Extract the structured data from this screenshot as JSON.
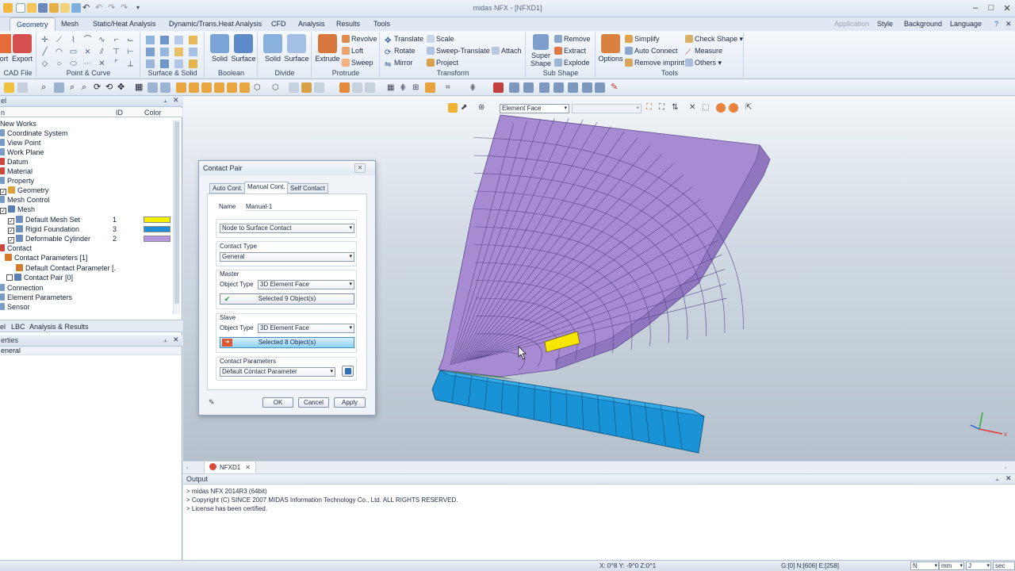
{
  "window": {
    "title": "midas NFX - [NFXD1]"
  },
  "menu_tabs": [
    "Geometry",
    "Mesh",
    "Static/Heat Analysis",
    "Dynamic/Trans.Heat Analysis",
    "CFD",
    "Analysis",
    "Results",
    "Tools"
  ],
  "right_menu": {
    "application": "Application",
    "style": "Style",
    "background": "Background",
    "language": "Language"
  },
  "ribbon": {
    "cad": {
      "label": "CAD File",
      "import": "ort",
      "export": "Export"
    },
    "point_curve": {
      "label": "Point & Curve"
    },
    "surface_solid": {
      "label": "Surface & Solid"
    },
    "boolean": {
      "label": "Boolean",
      "solid": "Solid",
      "surface": "Surface"
    },
    "divide": {
      "label": "Divide",
      "solid": "Solid",
      "surface": "Surface"
    },
    "protrude": {
      "label": "Protrude",
      "extrude": "Extrude",
      "revolve": "Revolve",
      "loft": "Loft",
      "sweep": "Sweep"
    },
    "transform": {
      "label": "Transform",
      "translate": "Translate",
      "rotate": "Rotate",
      "mirror": "Mirror",
      "scale": "Scale",
      "sweep_translate": "Sweep-Translate",
      "project": "Project",
      "attach": "Attach"
    },
    "sub_shape": {
      "label": "Sub Shape",
      "super_shape_1": "Super",
      "super_shape_2": "Shape",
      "remove": "Remove",
      "extract": "Extract",
      "explode": "Explode"
    },
    "tools": {
      "label": "Tools",
      "options": "Options",
      "simplify": "Simplify",
      "auto_connect": "Auto Connect",
      "remove_imprint": "Remove imprint",
      "check_shape": "Check Shape",
      "measure": "Measure",
      "others": "Others"
    }
  },
  "left_panel": {
    "head_fragment": "el",
    "columns": {
      "id": "ID",
      "color": "Color",
      "name_fragment": "n"
    },
    "tree": [
      {
        "label": "New Works",
        "indent": 0
      },
      {
        "label": "Coordinate System",
        "indent": 1
      },
      {
        "label": "View Point",
        "indent": 1
      },
      {
        "label": "Work Plane",
        "indent": 1
      },
      {
        "label": "Datum",
        "indent": 1
      },
      {
        "label": "Material",
        "indent": 1
      },
      {
        "label": "Property",
        "indent": 1
      },
      {
        "label": "Geometry",
        "indent": 1
      },
      {
        "label": "Mesh Control",
        "indent": 1
      },
      {
        "label": "Mesh",
        "indent": 1
      }
    ],
    "mesh_sets": [
      {
        "label": "Default Mesh Set",
        "id": "1",
        "color": "#f5f000"
      },
      {
        "label": "Rigid Foundation",
        "id": "3",
        "color": "#1e8fd6"
      },
      {
        "label": "Deformable Cylinder",
        "id": "2",
        "color": "#b396dc"
      }
    ],
    "tree2": [
      {
        "label": "Contact"
      },
      {
        "label": "Contact Parameters [1]"
      },
      {
        "label": "Default Contact Parameter [."
      },
      {
        "label": "Contact Pair [0]"
      },
      {
        "label": "Connection"
      },
      {
        "label": "Element Parameters"
      },
      {
        "label": "Sensor"
      }
    ],
    "bottom_tabs": [
      "el",
      "LBC",
      "Analysis & Results"
    ],
    "properties_head": "erties",
    "properties_row": "eneral"
  },
  "viewport": {
    "select_filter": "Element Face",
    "doc_tab": "NFXD1",
    "mesh_colors": {
      "cylinder": "#a489d2",
      "foundation": "#1a93d6",
      "selected": "#f7e600"
    }
  },
  "dialog": {
    "title": "Contact Pair",
    "tabs": [
      "Auto Cont.",
      "Manual Cont.",
      "Self Contact"
    ],
    "name_label": "Name",
    "name_value": "Manual-1",
    "contact_kind": "Node to Surface Contact",
    "contact_type_label": "Contact Type",
    "contact_type_value": "General",
    "master_label": "Master",
    "object_type_label": "Object Type",
    "master_object_type": "3D Element Face",
    "master_selected": "Selected 9 Object(s)",
    "slave_label": "Slave",
    "slave_object_type": "3D Element Face",
    "slave_selected": "Selected 8 Object(s)",
    "contact_params_label": "Contact Parameters",
    "contact_params_value": "Default Contact Parameter",
    "ok": "OK",
    "cancel": "Cancel",
    "apply": "Apply"
  },
  "output": {
    "title": "Output",
    "lines": [
      "> midas NFX 2014R3 (64bit)",
      "> Copyright (C) SINCE 2007 MIDAS Information Technology Co., Ltd. ALL RIGHTS RESERVED.",
      "> License has been certified."
    ]
  },
  "status": {
    "coords": "X: 0^8 Y: -9^0 Z:0^1",
    "counts": "G:[0] N:[606] E:[258]",
    "unit_force": "N",
    "unit_length": "mm",
    "unit_energy": "J",
    "unit_time": "sec"
  }
}
